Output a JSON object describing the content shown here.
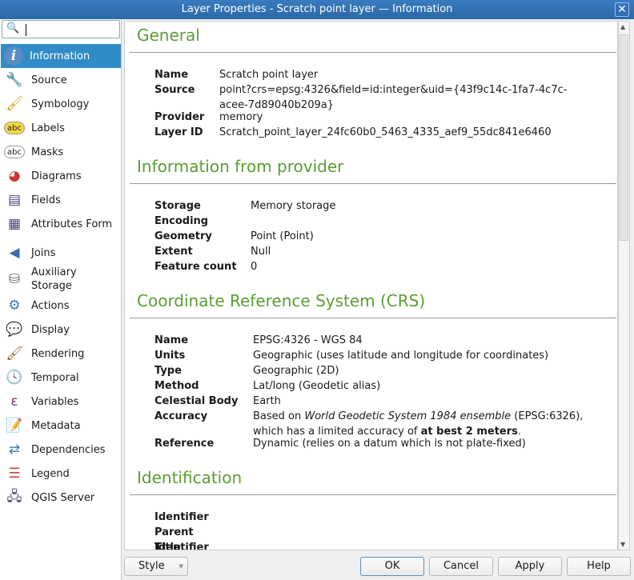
{
  "window": {
    "title": "Layer Properties - Scratch point layer — Information",
    "close": "✕"
  },
  "search": {
    "placeholder": ""
  },
  "sidebar": {
    "items": [
      {
        "label": "Information",
        "icon": "i"
      },
      {
        "label": "Source",
        "icon": "🔧"
      },
      {
        "label": "Symbology",
        "icon": "🖌"
      },
      {
        "label": "Labels",
        "icon": "abc"
      },
      {
        "label": "Masks",
        "icon": "abc"
      },
      {
        "label": "Diagrams",
        "icon": "◕"
      },
      {
        "label": "Fields",
        "icon": "▤"
      },
      {
        "label": "Attributes Form",
        "icon": "▦"
      },
      {
        "label": "Joins",
        "icon": "◀"
      },
      {
        "label": "Auxiliary\nStorage",
        "icon": "⛁"
      },
      {
        "label": "Actions",
        "icon": "⚙"
      },
      {
        "label": "Display",
        "icon": "💬"
      },
      {
        "label": "Rendering",
        "icon": "🖌"
      },
      {
        "label": "Temporal",
        "icon": "🕓"
      },
      {
        "label": "Variables",
        "icon": "ε"
      },
      {
        "label": "Metadata",
        "icon": "📝"
      },
      {
        "label": "Dependencies",
        "icon": "⇄"
      },
      {
        "label": "Legend",
        "icon": "☰"
      },
      {
        "label": "QGIS Server",
        "icon": "🖧"
      }
    ]
  },
  "sections": {
    "general": {
      "title": "General",
      "rows": [
        [
          "Name",
          "Scratch point layer"
        ],
        [
          "Source",
          "point?crs=epsg:4326&field=id:integer&uid={43f9c14c-1fa7-4c7c-acee-7d89040b209a}"
        ],
        [
          "Provider",
          "memory"
        ],
        [
          "Layer ID",
          "Scratch_point_layer_24fc60b0_5463_4335_aef9_55dc841e6460"
        ]
      ]
    },
    "provider": {
      "title": "Information from provider",
      "rows": [
        [
          "Storage",
          "Memory storage"
        ],
        [
          "Encoding",
          ""
        ],
        [
          "Geometry",
          "Point (Point)"
        ],
        [
          "Extent",
          "Null"
        ],
        [
          "Feature count",
          "0"
        ]
      ]
    },
    "crs": {
      "title": "Coordinate Reference System (CRS)",
      "rows": [
        [
          "Name",
          "EPSG:4326 - WGS 84"
        ],
        [
          "Units",
          "Geographic (uses latitude and longitude for coordinates)"
        ],
        [
          "Type",
          "Geographic (2D)"
        ],
        [
          "Method",
          "Lat/long (Geodetic alias)"
        ],
        [
          "Celestial Body",
          "Earth"
        ],
        [
          "Accuracy",
          ""
        ],
        [
          "Reference",
          "Dynamic (relies on a datum which is not plate-fixed)"
        ]
      ],
      "accuracy": {
        "p1": "Based on ",
        "em": "World Geodetic System 1984 ensemble",
        "p2": " (EPSG:6326),",
        "p3": "which has a limited accuracy of ",
        "strong": "at best 2 meters",
        "p4": "."
      }
    },
    "identification": {
      "title": "Identification",
      "rows": [
        [
          "Identifier",
          ""
        ],
        [
          "Parent Identifier",
          ""
        ],
        [
          "Title",
          ""
        ]
      ]
    }
  },
  "buttons": {
    "style": "Style",
    "ok": "OK",
    "cancel": "Cancel",
    "apply": "Apply",
    "help": "Help"
  }
}
